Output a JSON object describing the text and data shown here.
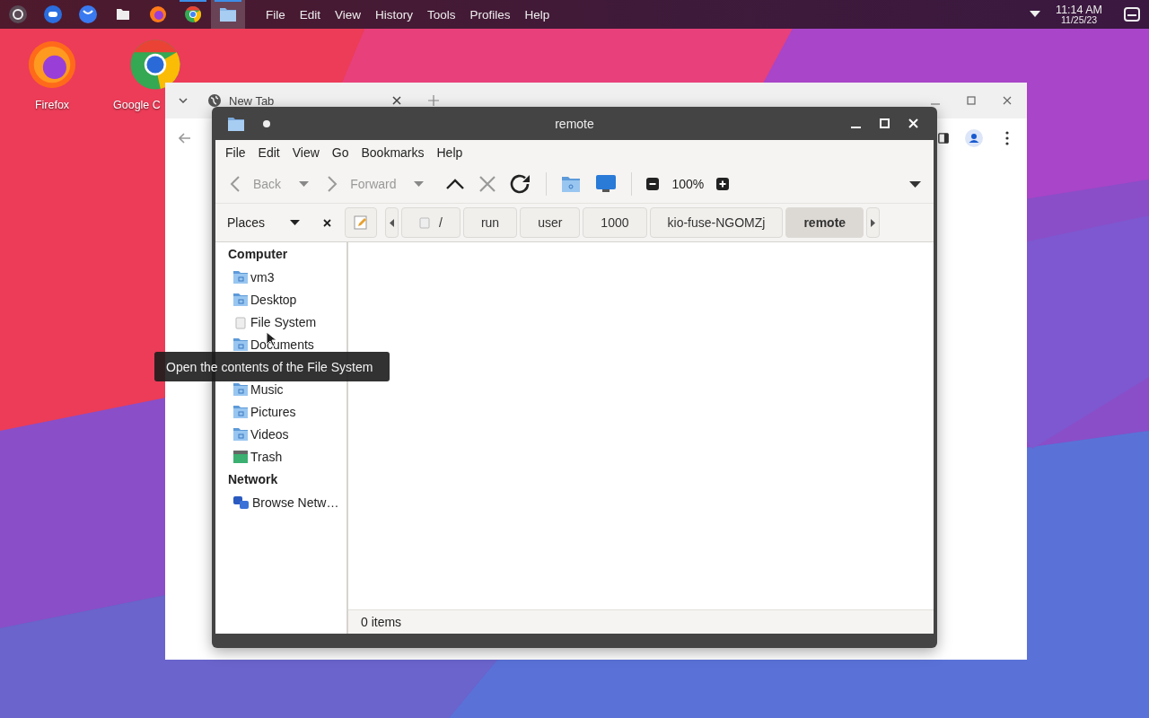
{
  "panel": {
    "launchers": [
      {
        "kind": "launcher",
        "running": false,
        "selected": false
      },
      {
        "kind": "toggle",
        "running": false,
        "selected": false
      },
      {
        "kind": "bubble",
        "running": false,
        "selected": false
      },
      {
        "kind": "files",
        "running": false,
        "selected": false
      },
      {
        "kind": "firefox",
        "running": false,
        "selected": false
      },
      {
        "kind": "chrome",
        "running": true,
        "selected": false
      },
      {
        "kind": "folder",
        "running": true,
        "selected": true
      }
    ],
    "menu": [
      "File",
      "Edit",
      "View",
      "History",
      "Tools",
      "Profiles",
      "Help"
    ],
    "clock": {
      "time": "11:14 AM",
      "date": "11/25/23"
    }
  },
  "desktop_icons": [
    {
      "kind": "firefox",
      "label": "Firefox"
    },
    {
      "kind": "chrome",
      "label": "Google C"
    }
  ],
  "browser": {
    "tab": {
      "title": "New Tab"
    }
  },
  "file_manager": {
    "title": "remote",
    "menu": [
      "File",
      "Edit",
      "View",
      "Go",
      "Bookmarks",
      "Help"
    ],
    "toolbar": {
      "back": {
        "label": "Back",
        "disabled": true
      },
      "forward": {
        "label": "Forward",
        "disabled": true
      },
      "up": {
        "disabled": false
      },
      "stop": {
        "disabled": true
      },
      "reload": {
        "disabled": false
      },
      "zoom": "100%"
    },
    "places_label": "Places",
    "breadcrumbs": [
      {
        "kind": "root",
        "label": "/",
        "selected": false
      },
      {
        "kind": "dir",
        "label": "run",
        "selected": false
      },
      {
        "kind": "dir",
        "label": "user",
        "selected": false
      },
      {
        "kind": "dir",
        "label": "1000",
        "selected": false
      },
      {
        "kind": "dir",
        "label": "kio-fuse-NGOMZj",
        "selected": false
      },
      {
        "kind": "dir",
        "label": "remote",
        "selected": true
      }
    ],
    "sidebar": [
      {
        "kind": "header",
        "label": "Computer"
      },
      {
        "kind": "home",
        "label": "vm3"
      },
      {
        "kind": "desktop",
        "label": "Desktop"
      },
      {
        "kind": "drive",
        "label": "File System"
      },
      {
        "kind": "documents",
        "label": "Documents"
      },
      {
        "kind": "tooltip",
        "label": "Open the contents of the File System"
      },
      {
        "kind": "music",
        "label": "Music"
      },
      {
        "kind": "pictures",
        "label": "Pictures"
      },
      {
        "kind": "videos",
        "label": "Videos"
      },
      {
        "kind": "trash",
        "label": "Trash"
      },
      {
        "kind": "header",
        "label": "Network"
      },
      {
        "kind": "network",
        "label": "Browse Netw…"
      }
    ],
    "status": "0 items"
  }
}
